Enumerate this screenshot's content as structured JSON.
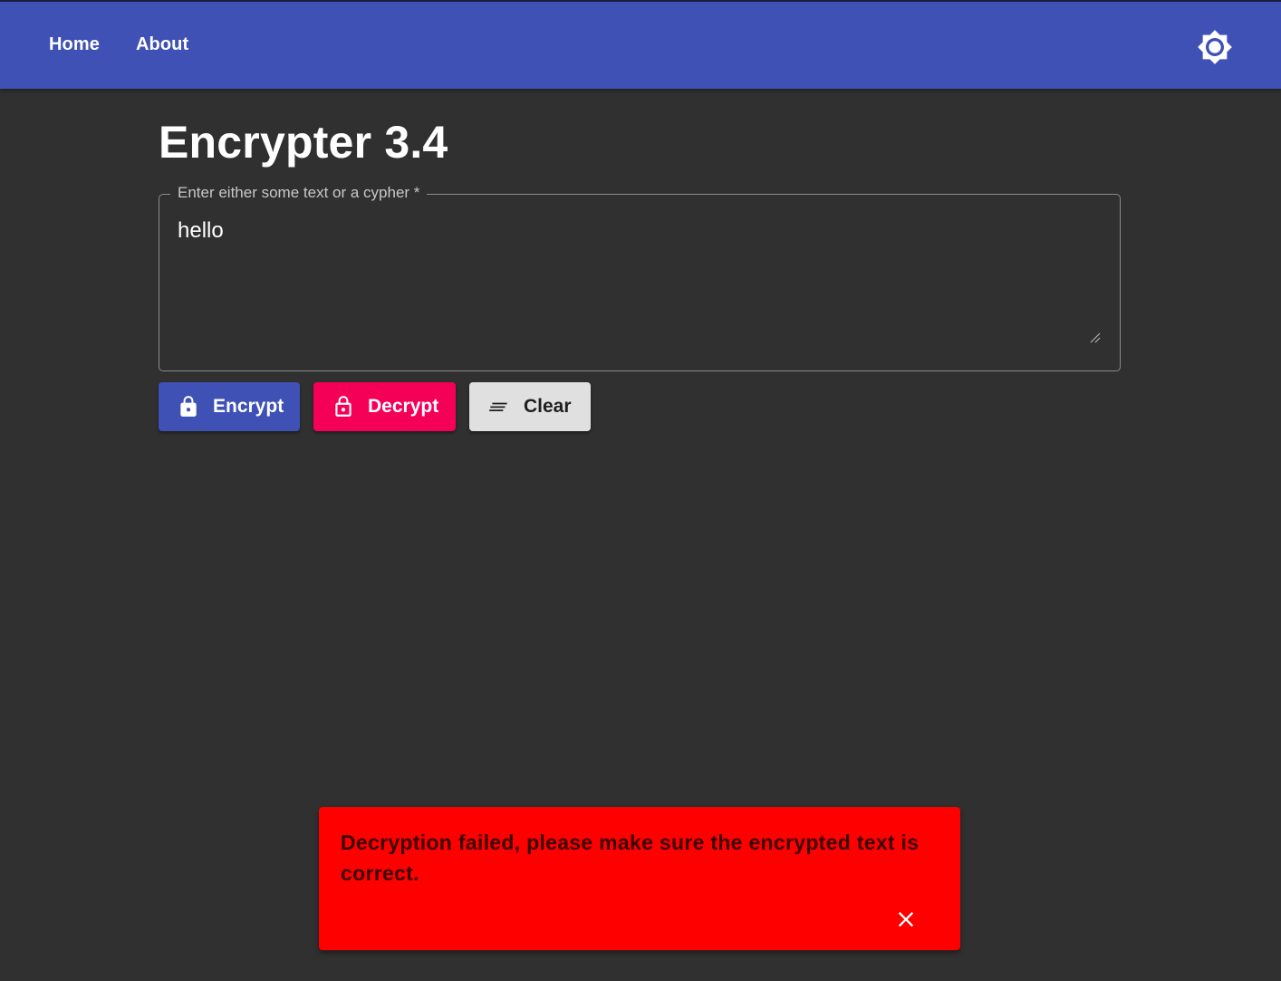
{
  "nav": {
    "home_label": "Home",
    "about_label": "About",
    "theme_icon": "brightness-icon"
  },
  "page": {
    "title": "Encrypter 3.4"
  },
  "input": {
    "label": "Enter either some text or a cypher *",
    "value": "hello"
  },
  "actions": {
    "encrypt_label": "Encrypt",
    "encrypt_icon": "lock-icon",
    "decrypt_label": "Decrypt",
    "decrypt_icon": "lock-open-icon",
    "clear_label": "Clear",
    "clear_icon": "lines-icon"
  },
  "snackbar": {
    "message": "Decryption failed, please make sure the encrypted text is correct.",
    "close_icon": "close-icon"
  },
  "colors": {
    "primary": "#3f51b5",
    "secondary": "#f50057",
    "background": "#303030",
    "error": "#ff0000",
    "clear_button": "#e0e0e0"
  }
}
